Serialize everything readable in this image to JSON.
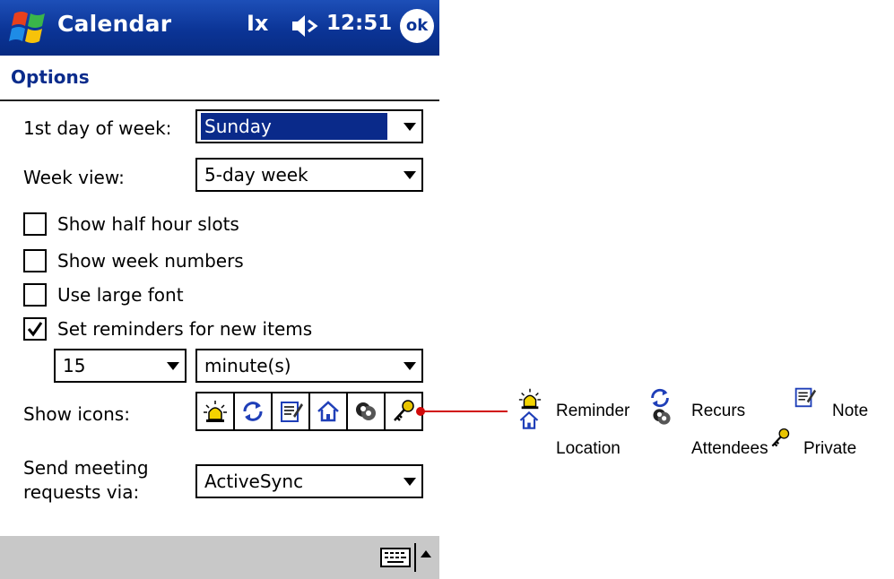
{
  "titlebar": {
    "app_title": "Calendar",
    "connectivity_glyph": "Ix",
    "time": "12:51",
    "ok_label": "ok",
    "icons": [
      "windows-start-icon",
      "connectivity-icon",
      "volume-icon"
    ]
  },
  "options": {
    "header": "Options",
    "first_day": {
      "label": "1st day of week:",
      "value": "Sunday"
    },
    "week_view": {
      "label": "Week view:",
      "value": "5-day week"
    },
    "checkboxes": [
      {
        "label": "Show half hour slots",
        "checked": false
      },
      {
        "label": "Show week numbers",
        "checked": false
      },
      {
        "label": "Use large font",
        "checked": false
      },
      {
        "label": "Set reminders for new items",
        "checked": true
      }
    ],
    "reminder": {
      "amount": "15",
      "unit": "minute(s)"
    },
    "show_icons": {
      "label": "Show icons:",
      "icons": [
        "reminder-bell-icon",
        "recurs-icon",
        "note-icon",
        "location-house-icon",
        "attendees-icon",
        "private-key-icon"
      ]
    },
    "send_meeting": {
      "label_line1": "Send meeting",
      "label_line2": "requests via:",
      "value": "ActiveSync"
    }
  },
  "menubar": {
    "icons": [
      "keyboard-icon",
      "sip-arrow-icon"
    ]
  },
  "legend": {
    "reminder": "Reminder",
    "recurs": "Recurs",
    "note": "Note",
    "location": "Location",
    "attendees": "Attendees",
    "private": "Private"
  },
  "colors": {
    "titlebar": "#0b3496",
    "header_text": "#0b2c8c",
    "selection": "#0a2a8a",
    "menubar": "#c8c8c8",
    "callout": "#d10a0a"
  }
}
